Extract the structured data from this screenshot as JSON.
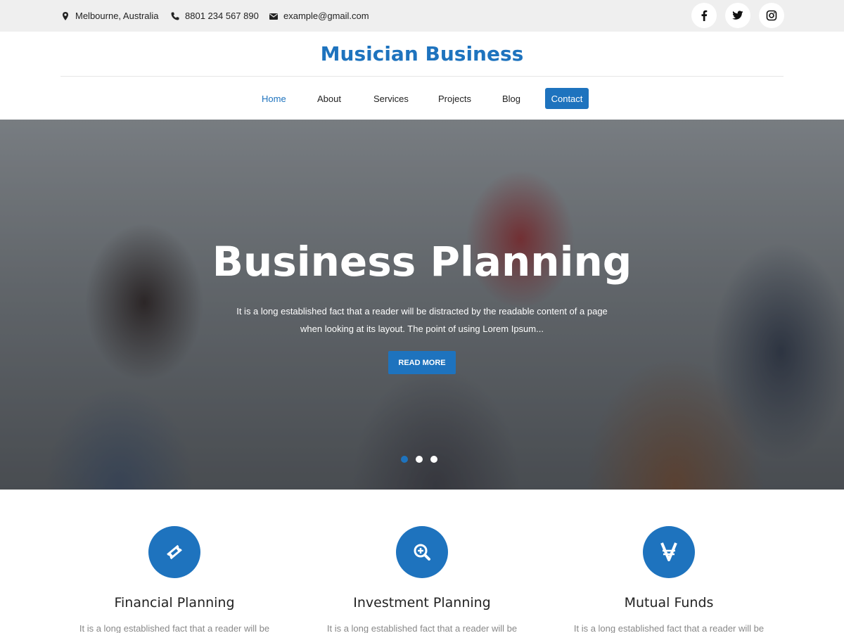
{
  "topbar": {
    "location": "Melbourne, Australia",
    "location_icon": "map-marker-icon",
    "phone": "8801 234 567 890",
    "phone_icon": "phone-icon",
    "email": "example@gmail.com",
    "email_icon": "envelope-icon",
    "social": [
      "facebook-icon",
      "twitter-icon",
      "instagram-icon"
    ]
  },
  "header": {
    "site_title": "Musician Business"
  },
  "nav": {
    "items": [
      {
        "label": "Home",
        "active": true
      },
      {
        "label": "About"
      },
      {
        "label": "Services"
      },
      {
        "label": "Projects"
      },
      {
        "label": "Blog"
      },
      {
        "label": "Contact",
        "highlight": true
      }
    ]
  },
  "hero": {
    "title": "Business Planning",
    "text": "It is a long established fact that a reader will be distracted by the readable content of a page when looking at its layout. The point of using Lorem Ipsum...",
    "button": "READ MORE",
    "slides": 3,
    "active_slide": 1
  },
  "features": [
    {
      "icon": "ticket-icon",
      "title": "Financial Planning",
      "text": "It is a long established fact that a reader will be"
    },
    {
      "icon": "search-plus-icon",
      "title": "Investment Planning",
      "text": "It is a long established fact that a reader will be"
    },
    {
      "icon": "viacoin-icon",
      "title": "Mutual Funds",
      "text": "It is a long established fact that a reader will be"
    }
  ],
  "colors": {
    "accent": "#1e73be",
    "topbar_bg": "#efefef",
    "body_text": "#222222",
    "muted_text": "#888888"
  }
}
